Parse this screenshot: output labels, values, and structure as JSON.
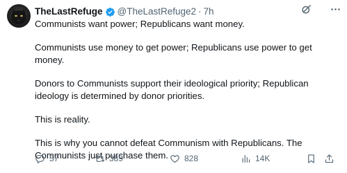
{
  "tweet": {
    "author_name": "TheLastRefuge",
    "handle": "@TheLastRefuge2",
    "separator": "·",
    "time": "7h",
    "paragraphs": [
      "Communists want power; Republicans want money.",
      "Communists use money to get power; Republicans use power to get money.",
      "Donors to Communists support their ideological priority; Republican ideology is determined by donor priorities.",
      "This is reality.",
      "This is why you cannot defeat Communism with Republicans.  The Communists just purchase them."
    ]
  },
  "actions": {
    "replies": "57",
    "retweets": "389",
    "likes": "828",
    "views": "14K"
  },
  "icons": {
    "verified": "verified-badge-icon",
    "grok": "grok-icon",
    "more": "more-icon",
    "reply": "reply-icon",
    "retweet": "retweet-icon",
    "like": "heart-icon",
    "views": "views-icon",
    "bookmark": "bookmark-icon",
    "share": "share-icon"
  },
  "colors": {
    "text": "#0f1419",
    "secondary": "#536471",
    "verified": "#1d9bf0"
  }
}
